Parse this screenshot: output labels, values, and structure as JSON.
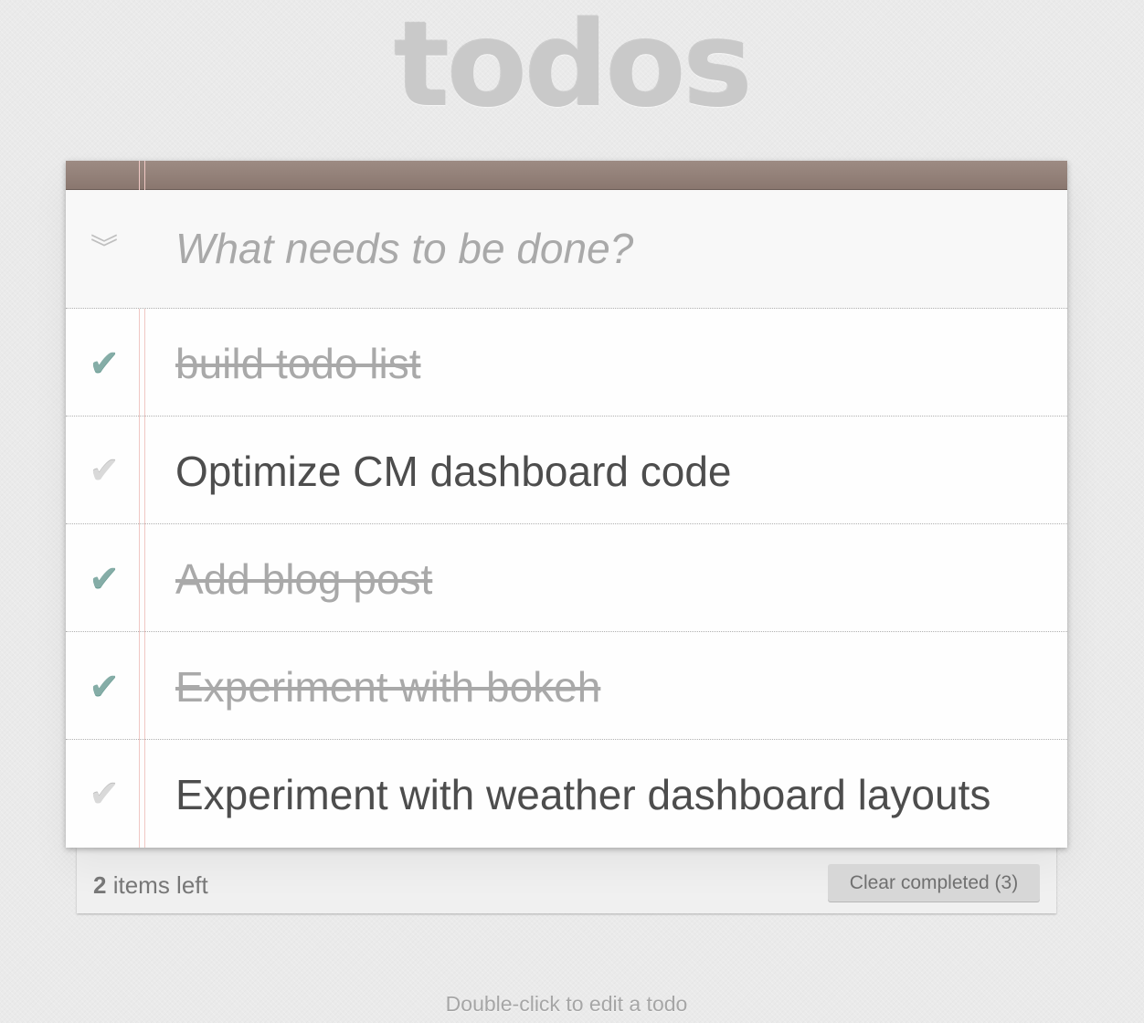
{
  "app": {
    "title": "todos"
  },
  "new_todo": {
    "placeholder": "What needs to be done?",
    "value": "",
    "toggle_all_icon": "double-chevron-down-icon"
  },
  "todos": [
    {
      "label": "build todo list",
      "completed": true
    },
    {
      "label": "Optimize CM dashboard code",
      "completed": false
    },
    {
      "label": "Add blog post",
      "completed": true
    },
    {
      "label": "Experiment with bokeh",
      "completed": true
    },
    {
      "label": "Experiment with weather dashboard layouts",
      "completed": false
    }
  ],
  "footer": {
    "items_left_count": "2",
    "items_left_text": "items left",
    "clear_completed_label": "Clear completed (3)"
  },
  "info": {
    "text": "Double-click to edit a todo"
  },
  "colors": {
    "check_done": "#85ada7",
    "check_open": "#d9d9d9",
    "header_bar": "#8a776f",
    "margin_line": "#f0c8c4"
  }
}
